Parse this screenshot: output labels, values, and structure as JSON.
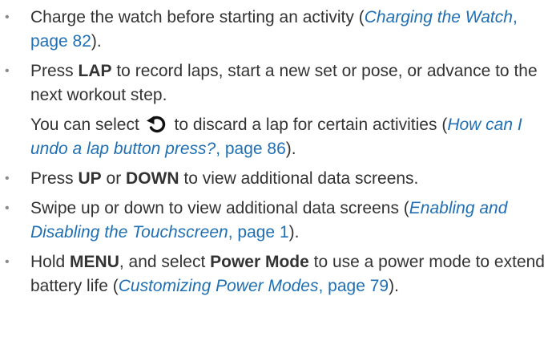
{
  "items": [
    {
      "parts": [
        {
          "t": "text",
          "v": "Charge the watch before starting an activity ("
        },
        {
          "t": "link",
          "title": "Charging the Watch",
          "page": ", page 82"
        },
        {
          "t": "text",
          "v": ")."
        }
      ]
    },
    {
      "parts": [
        {
          "t": "text",
          "v": "Press "
        },
        {
          "t": "bold",
          "v": "LAP"
        },
        {
          "t": "text",
          "v": " to record laps, start a new set or pose, or advance to the next workout step."
        }
      ],
      "extra": [
        {
          "t": "text",
          "v": "You can select "
        },
        {
          "t": "icon",
          "name": "undo-icon"
        },
        {
          "t": "text",
          "v": " to discard a lap for certain activities ("
        },
        {
          "t": "link",
          "title": "How can I undo a lap button press?",
          "page": ", page 86"
        },
        {
          "t": "text",
          "v": ")."
        }
      ]
    },
    {
      "parts": [
        {
          "t": "text",
          "v": "Press "
        },
        {
          "t": "bold",
          "v": "UP"
        },
        {
          "t": "text",
          "v": " or "
        },
        {
          "t": "bold",
          "v": "DOWN"
        },
        {
          "t": "text",
          "v": " to view additional data screens."
        }
      ]
    },
    {
      "parts": [
        {
          "t": "text",
          "v": "Swipe up or down to view additional data screens ("
        },
        {
          "t": "link",
          "title": "Enabling and Disabling the Touchscreen",
          "page": ", page 1"
        },
        {
          "t": "text",
          "v": ")."
        }
      ]
    },
    {
      "parts": [
        {
          "t": "text",
          "v": "Hold "
        },
        {
          "t": "bold",
          "v": "MENU"
        },
        {
          "t": "text",
          "v": ", and select "
        },
        {
          "t": "bold",
          "v": "Power Mode"
        },
        {
          "t": "text",
          "v": " to use a power mode to extend battery life ("
        },
        {
          "t": "link",
          "title": "Customizing Power Modes",
          "page": ", page 79"
        },
        {
          "t": "text",
          "v": ")."
        }
      ]
    }
  ],
  "bullet_char": "•",
  "colors": {
    "text": "#333333",
    "link": "#1f6fb5",
    "bullet": "#8a8a8a"
  }
}
